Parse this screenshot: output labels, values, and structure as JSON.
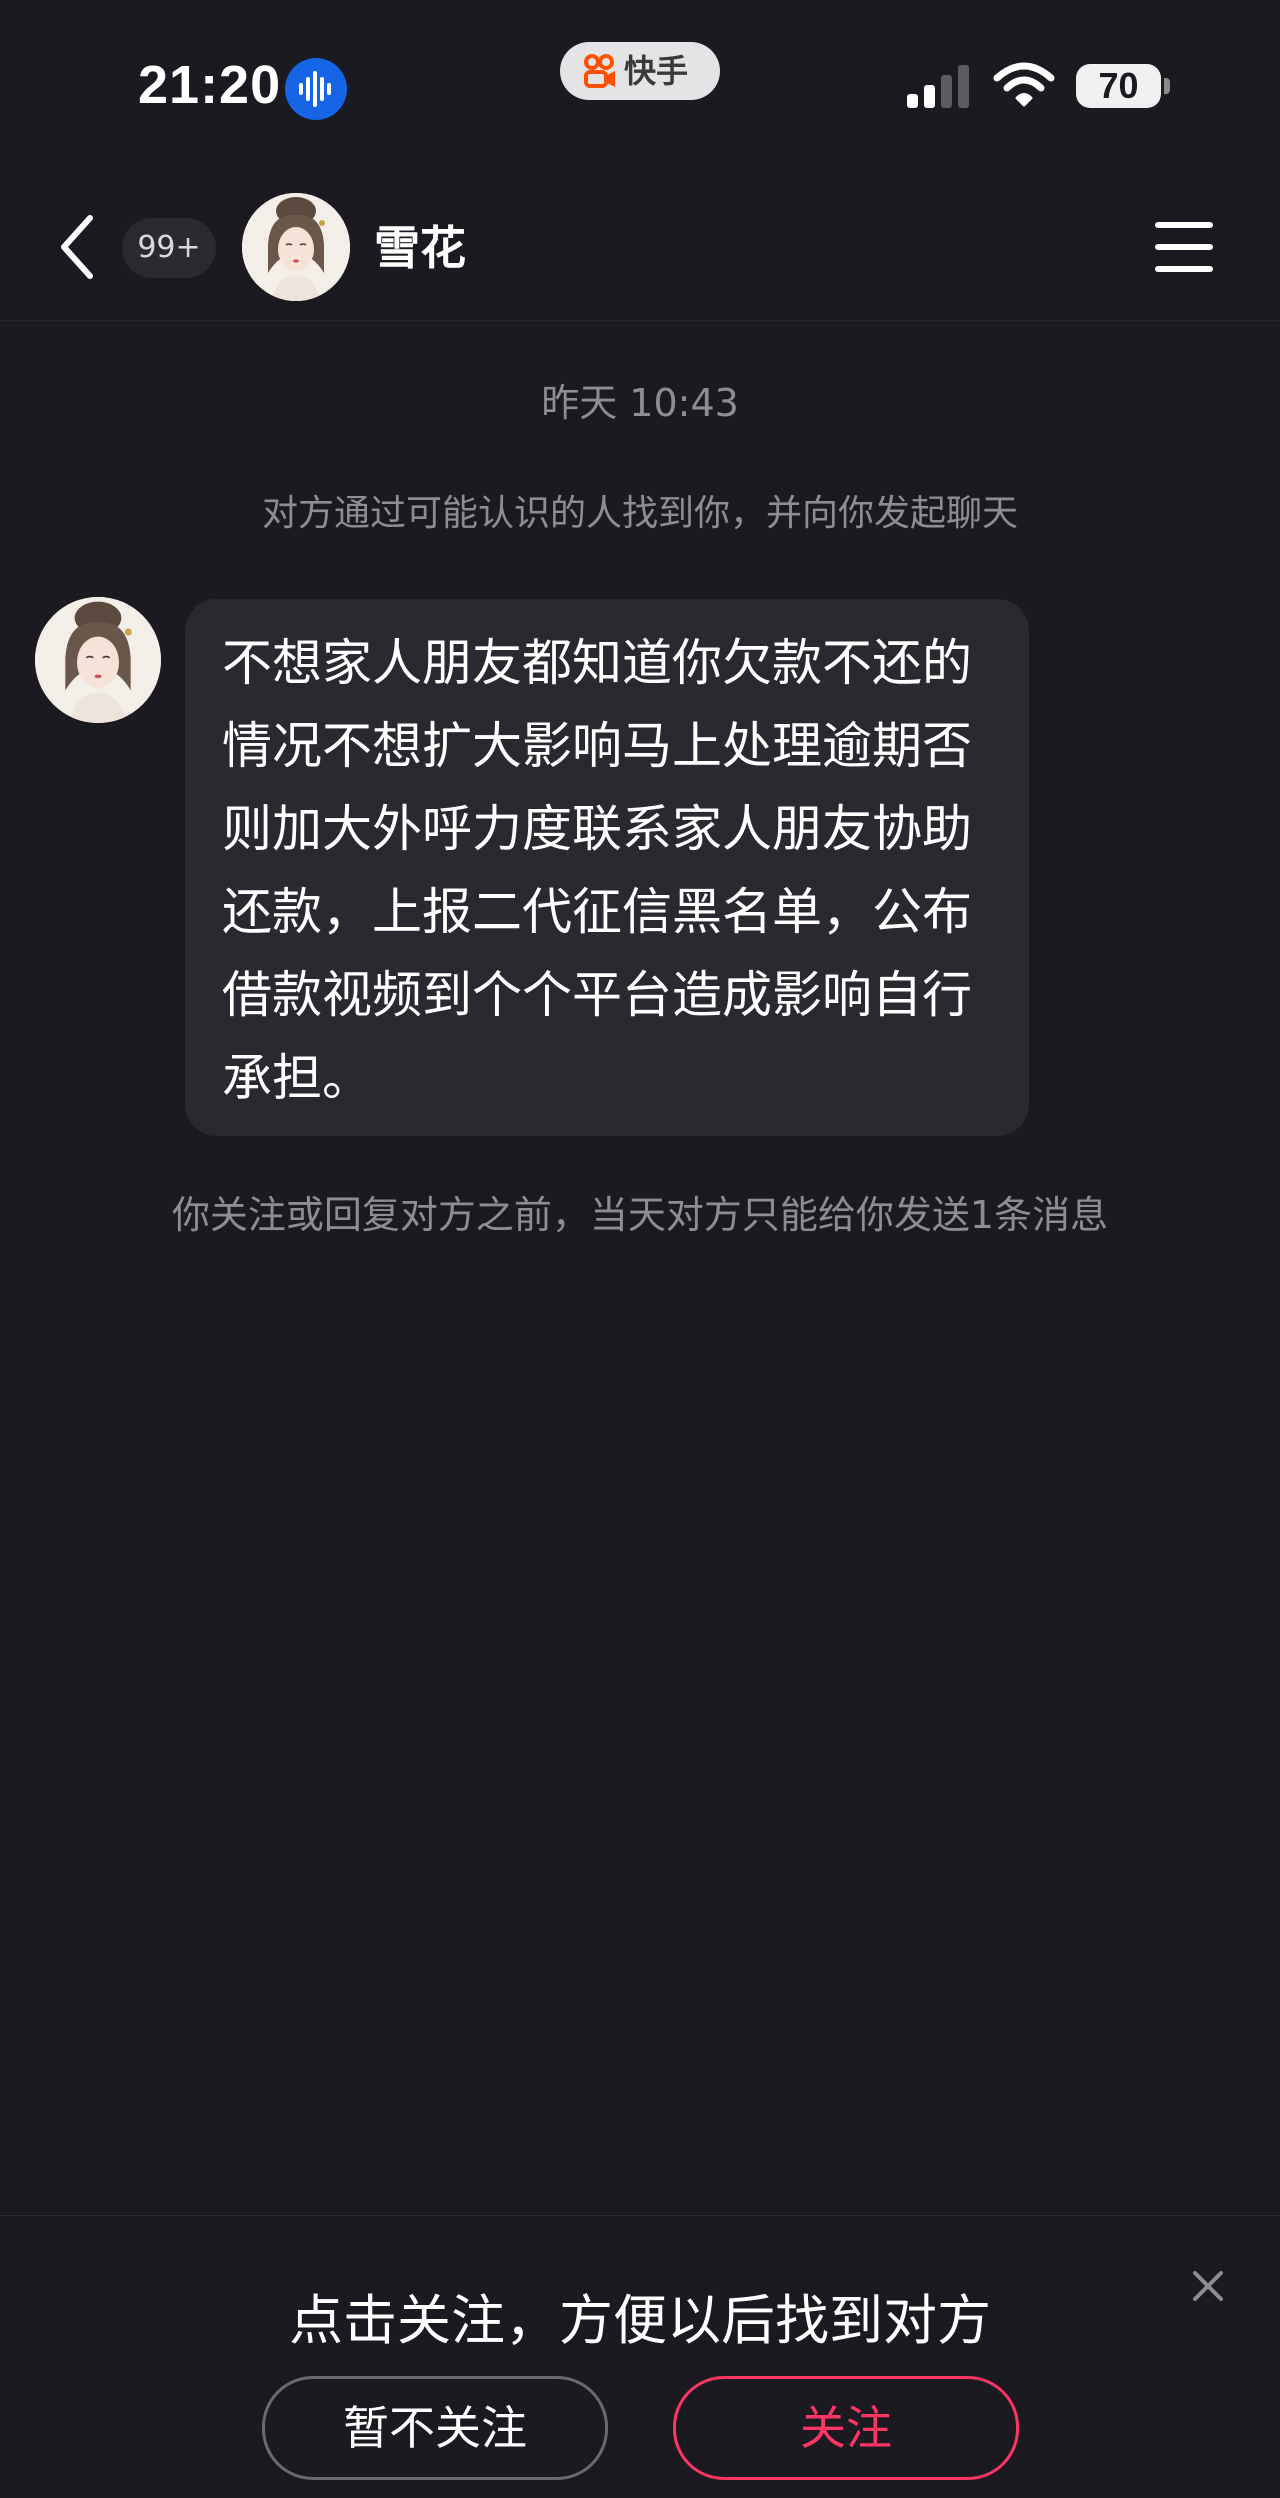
{
  "status_bar": {
    "time": "21:20",
    "voice_icon": "voice-waveform-icon",
    "app_badge": {
      "icon": "kuaishou-icon",
      "label": "快手"
    },
    "signal_icon": "cellular-signal-icon",
    "wifi_icon": "wifi-icon",
    "battery_level": "70"
  },
  "header": {
    "back_icon": "chevron-left-icon",
    "unread_count": "99+",
    "contact_name": "雪花",
    "menu_icon": "hamburger-menu-icon"
  },
  "conversation": {
    "timestamp": "昨天 10:43",
    "system_notice": "对方通过可能认识的人找到你，并向你发起聊天",
    "messages": [
      {
        "sender": "雪花",
        "text": "不想家人朋友都知道你欠款不还的情况不想扩大影响马上处理逾期否则加大外呼力度联系家人朋友协助还款，上报二代征信黑名单，公布借款视频到个个平台造成影响自行承担。"
      }
    ],
    "limit_notice": "你关注或回复对方之前，当天对方只能给你发送1条消息"
  },
  "follow_panel": {
    "prompt": "点击关注，方便以后找到对方",
    "skip_label": "暂不关注",
    "follow_label": "关注",
    "close_icon": "close-icon"
  },
  "colors": {
    "background": "#1b1a20",
    "bubble": "#2a292f",
    "muted_text": "#8e8d94",
    "accent": "#fe3666",
    "voice_icon_bg": "#1565e6",
    "kuaishou_orange": "#ff5000"
  }
}
